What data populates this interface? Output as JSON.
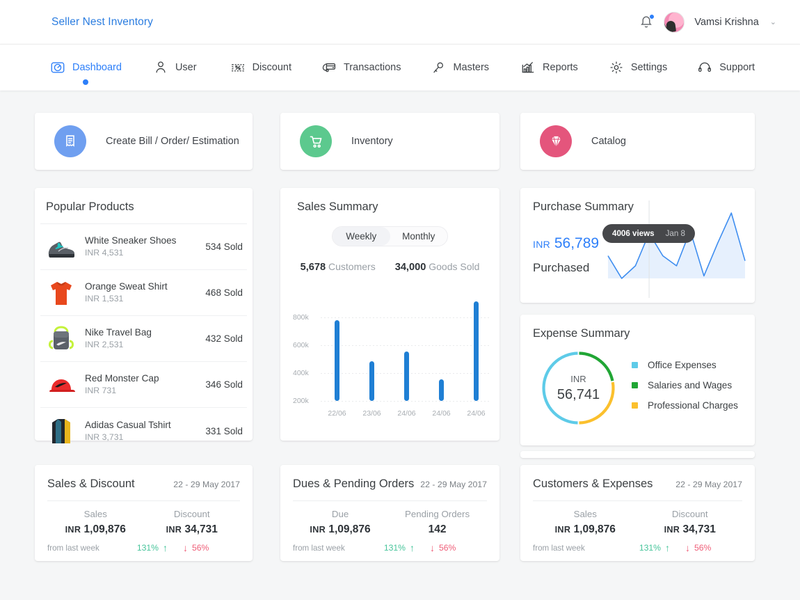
{
  "header": {
    "brand": "Seller Nest Inventory",
    "bell_icon": "bell-icon",
    "username": "Vamsi Krishna",
    "caret": "⌄"
  },
  "nav": {
    "items": [
      {
        "label": "Dashboard",
        "icon": "speedometer-icon",
        "active": true
      },
      {
        "label": "User",
        "icon": "user-icon",
        "active": false
      },
      {
        "label": "Discount",
        "icon": "coupon-icon",
        "active": false
      },
      {
        "label": "Transactions",
        "icon": "card-swipe-icon",
        "active": false
      },
      {
        "label": "Masters",
        "icon": "key-icon",
        "active": false
      },
      {
        "label": "Reports",
        "icon": "bar-chart-icon",
        "active": false
      },
      {
        "label": "Settings",
        "icon": "gear-icon",
        "active": false
      },
      {
        "label": "Support",
        "icon": "headset-icon",
        "active": false
      }
    ]
  },
  "quick_actions": [
    {
      "label": "Create Bill / Order/ Estimation",
      "icon": "invoice-icon",
      "color": "#6f9ff0"
    },
    {
      "label": "Inventory",
      "icon": "cart-icon",
      "color": "#5cc98e"
    },
    {
      "label": "Catalog",
      "icon": "diamond-icon",
      "color": "#e4557c"
    }
  ],
  "popular_products": {
    "title": "Popular Products",
    "items": [
      {
        "name": "White Sneaker Shoes",
        "price": "INR  4,531",
        "sold": "534 Sold",
        "icon": "sneaker-thumb"
      },
      {
        "name": "Orange Sweat Shirt",
        "price": "INR  1,531",
        "sold": "468 Sold",
        "icon": "tshirt-thumb"
      },
      {
        "name": "Nike Travel Bag",
        "price": "INR  2,531",
        "sold": "432 Sold",
        "icon": "bag-thumb"
      },
      {
        "name": "Red Monster Cap",
        "price": "INR  731",
        "sold": "346 Sold",
        "icon": "cap-thumb"
      },
      {
        "name": "Adidas Casual Tshirt",
        "price": "INR  3,731",
        "sold": "331 Sold",
        "icon": "jacket-thumb"
      }
    ]
  },
  "sales_summary": {
    "title": "Sales Summary",
    "toggle": {
      "weekly": "Weekly",
      "monthly": "Monthly",
      "selected": "Weekly"
    },
    "kpis": [
      {
        "value": "5,678",
        "label": "Customers"
      },
      {
        "value": "34,000",
        "label": "Goods Sold"
      }
    ]
  },
  "purchase_summary": {
    "title": "Purchase Summary",
    "currency": "INR",
    "amount": "56,789",
    "caption": "Purchased",
    "tooltip": {
      "views": "4006 views",
      "date": "Jan 8"
    }
  },
  "expense_summary": {
    "title": "Expense Summary",
    "currency": "INR",
    "amount": "56,741",
    "legend": [
      {
        "label": "Office Expenses",
        "color": "#5ecbe8"
      },
      {
        "label": "Salaries and Wages",
        "color": "#21a635"
      },
      {
        "label": "Professional Charges",
        "color": "#fbc02d"
      }
    ]
  },
  "stat_cards": [
    {
      "title": "Sales & Discount",
      "range": "22 - 29  May 2017",
      "left": {
        "label": "Sales",
        "currency": "INR",
        "value": "1,09,876"
      },
      "right": {
        "label": "Discount",
        "currency": "INR",
        "value": "34,731"
      },
      "from_last": "from last week",
      "up": "131%",
      "down": "56%"
    },
    {
      "title": "Dues & Pending Orders",
      "range": "22 - 29  May 2017",
      "left": {
        "label": "Due",
        "currency": "INR",
        "value": "1,09,876"
      },
      "right": {
        "label": "Pending Orders",
        "currency": "",
        "value": "142"
      },
      "from_last": "from last week",
      "up": "131%",
      "down": "56%"
    },
    {
      "title": "Customers & Expenses",
      "range": "22 - 29  May 2017",
      "left": {
        "label": "Sales",
        "currency": "INR",
        "value": "1,09,876"
      },
      "right": {
        "label": "Discount",
        "currency": "INR",
        "value": "34,731"
      },
      "from_last": "from last week",
      "up": "131%",
      "down": "56%"
    }
  ],
  "chart_data": [
    {
      "type": "bar",
      "title": "Sales Summary",
      "categories": [
        "22/06",
        "23/06",
        "24/06",
        "24/06",
        "24/06"
      ],
      "values": [
        780000,
        485000,
        553000,
        355000,
        915000
      ],
      "ytick_labels": [
        "800k",
        "600k",
        "400k",
        "200k"
      ],
      "ytick_values": [
        800000,
        600000,
        400000,
        200000
      ],
      "ylim": [
        200000,
        1000000
      ],
      "xlabel": "",
      "ylabel": "",
      "grid": true,
      "legend": "none",
      "series_color": "#1f7fd4",
      "baseline": 200000
    },
    {
      "type": "area",
      "title": "Purchase Summary",
      "x": [
        0,
        1,
        2,
        3,
        4,
        5,
        6,
        7,
        8,
        9,
        10
      ],
      "values": [
        52,
        34,
        44,
        70,
        52,
        44,
        72,
        36,
        62,
        86,
        48
      ],
      "annotation": {
        "label": "4006 views",
        "date": "Jan 8",
        "x_index": 3
      },
      "line_color": "#3f8ef0",
      "fill_color": "#e6f0fd",
      "grid": false,
      "legend": "none"
    },
    {
      "type": "pie",
      "title": "Expense Summary",
      "subtype": "donut",
      "labels": [
        "Office Expenses",
        "Salaries and Wages",
        "Professional Charges"
      ],
      "values": [
        50,
        22,
        28
      ],
      "colors": [
        "#5ecbe8",
        "#21a635",
        "#fbc02d"
      ],
      "center_label": "INR",
      "center_value": "56,741",
      "legend": "right"
    }
  ]
}
